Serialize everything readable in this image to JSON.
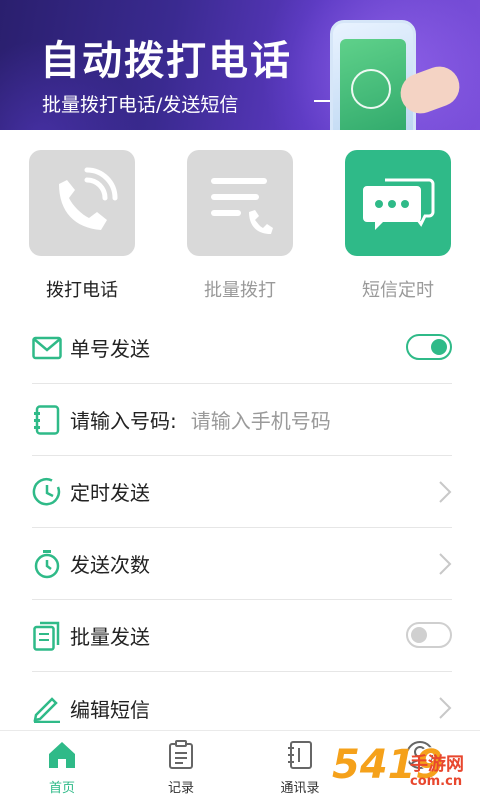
{
  "banner": {
    "title": "自动拨打电话",
    "subtitle": "批量拨打电话/发送短信"
  },
  "quick_actions": [
    {
      "label": "拨打电话",
      "icon": "phone-call-icon",
      "state": "inactive"
    },
    {
      "label": "批量拨打",
      "icon": "batch-call-icon",
      "state": "inactive"
    },
    {
      "label": "短信定时",
      "icon": "sms-chat-icon",
      "state": "active"
    }
  ],
  "settings": {
    "single_send": {
      "label": "单号发送",
      "icon": "envelope-icon",
      "toggle_on": true
    },
    "phone_input": {
      "label": "请输入号码:",
      "placeholder": "请输入手机号码",
      "icon": "contact-book-icon"
    },
    "scheduled_send": {
      "label": "定时发送",
      "icon": "clock-icon"
    },
    "send_count": {
      "label": "发送次数",
      "icon": "stopwatch-icon"
    },
    "batch_send": {
      "label": "批量发送",
      "icon": "documents-icon",
      "toggle_on": false
    },
    "edit_sms": {
      "label": "编辑短信",
      "icon": "pencil-icon"
    }
  },
  "tabbar": [
    {
      "label": "首页",
      "icon": "home-icon",
      "active": true
    },
    {
      "label": "记录",
      "icon": "clipboard-icon",
      "active": false
    },
    {
      "label": "通讯录",
      "icon": "address-book-icon",
      "active": false
    },
    {
      "label": "",
      "icon": "profile-icon",
      "active": false
    }
  ],
  "watermark": {
    "number": "5419",
    "text": "手游网",
    "url": "com.cn"
  },
  "colors": {
    "accent": "#2fba88",
    "banner": "#3a2a90",
    "inactive_tile": "#d9d9d9"
  }
}
